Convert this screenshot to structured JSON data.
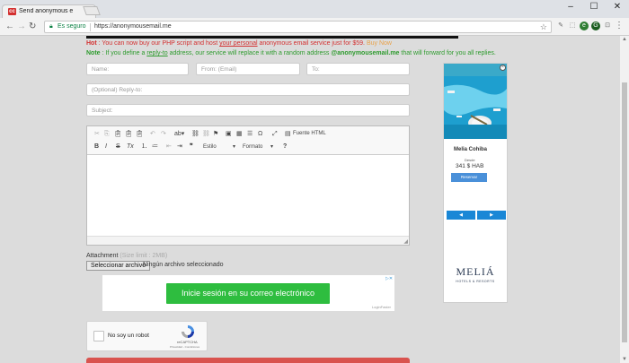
{
  "browser": {
    "tab_title": "Send anonymous email",
    "tab_favicon": "cc",
    "address_secure_label": "Es seguro",
    "address_url": "https://anonymousemail.me"
  },
  "notices": {
    "hot_label": "Hot",
    "hot_text_1": " : You can now buy our PHP script and host ",
    "hot_link": "your personal",
    "hot_text_2": " anonymous email service just for $59. ",
    "hot_buy": "Buy Now",
    "note_label": "Note",
    "note_text_1": " : If you define a ",
    "note_link": "reply-to",
    "note_text_2": " address, our service will replace it with a random address ",
    "note_email": "@anonymousemail.me",
    "note_text_3": " that will forward for you all replies."
  },
  "form": {
    "name_placeholder": "Name:",
    "from_placeholder": "From: (Email)",
    "to_placeholder": "To:",
    "replyto_placeholder": "(Optional) Reply-to:",
    "subject_placeholder": "Subject:"
  },
  "editor": {
    "source_label": "Fuente HTML",
    "style_label": "Estilo",
    "format_label": "Formato",
    "help_label": "?"
  },
  "attachment": {
    "label": "Attachment",
    "size_limit": "(Size limit : 2MB)",
    "button_label": "Seleccionar archivo",
    "status": "Ningún archivo seleccionado"
  },
  "ad_banner": {
    "button_label": "Inicie sesión en su correo electrónico",
    "footer": "LoginFaster"
  },
  "captcha": {
    "label": "No soy un robot",
    "brand": "reCAPTCHA",
    "terms": "Privacidad - Condiciones"
  },
  "side_ad": {
    "hotel": "Melia Cohiba",
    "desde": "Desde",
    "price": "341 $ HAB",
    "cta": "Reservar",
    "brand": "MELIÁ",
    "brand_sub": "HOTELS & RESORTS"
  }
}
